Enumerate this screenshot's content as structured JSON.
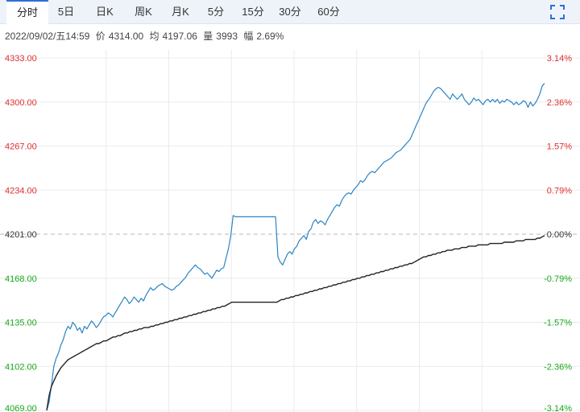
{
  "tabs": [
    {
      "label": "分时",
      "active": true
    },
    {
      "label": "5日",
      "active": false
    },
    {
      "label": "日K",
      "active": false
    },
    {
      "label": "周K",
      "active": false
    },
    {
      "label": "月K",
      "active": false
    },
    {
      "label": "5分",
      "active": false
    },
    {
      "label": "15分",
      "active": false
    },
    {
      "label": "30分",
      "active": false
    },
    {
      "label": "60分",
      "active": false
    }
  ],
  "toolbar": {
    "fullscreen_icon": "fullscreen-icon"
  },
  "info": {
    "datetime": "2022/09/02/五14:59",
    "price_label": "价",
    "price": "4314.00",
    "avg_label": "均",
    "avg": "4197.06",
    "volume_label": "量",
    "volume": "3993",
    "change_label": "幅",
    "change": "2.69%"
  },
  "colors": {
    "up": "#e03030",
    "down": "#1aa81a",
    "neutral": "#333333",
    "price_line": "#2b84c4",
    "avg_line": "#222222",
    "grid": "#e8ecf0",
    "tab_active": "#2d6fd6"
  },
  "chart_data": {
    "type": "line",
    "ylim": [
      4069,
      4333
    ],
    "base": 4201,
    "y_ticks": [
      "4333.00",
      "4300.00",
      "4267.00",
      "4234.00",
      "4201.00",
      "4168.00",
      "4135.00",
      "4102.00",
      "4069.00"
    ],
    "pct_ticks": [
      "3.14%",
      "2.36%",
      "1.57%",
      "0.79%",
      "0.00%",
      "-0.79%",
      "-1.57%",
      "-2.36%",
      "-3.14%"
    ],
    "series": [
      {
        "values": [
          4069,
          4075,
          4088,
          4102,
          4108,
          4112,
          4118,
          4122,
          4128,
          4132,
          4130,
          4135,
          4133,
          4129,
          4131,
          4127,
          4132,
          4130,
          4133,
          4136,
          4134,
          4131,
          4133,
          4136,
          4139,
          4140,
          4142,
          4141,
          4139,
          4142,
          4145,
          4148,
          4151,
          4154,
          4152,
          4149,
          4151,
          4154,
          4152,
          4150,
          4153,
          4151,
          4155,
          4158,
          4161,
          4159,
          4160,
          4162,
          4163,
          4164,
          4162,
          4161,
          4160,
          4159,
          4160,
          4162,
          4163,
          4165,
          4167,
          4169,
          4172,
          4174,
          4176,
          4178,
          4176,
          4175,
          4173,
          4171,
          4172,
          4170,
          4168,
          4171,
          4174,
          4173,
          4175,
          4176,
          4183,
          4190,
          4200,
          4215,
          4214,
          4214,
          4214,
          4214,
          4214,
          4214,
          4214,
          4214,
          4214,
          4214,
          4214,
          4214,
          4214,
          4214,
          4214,
          4214,
          4214,
          4214,
          4184,
          4180,
          4178,
          4182,
          4186,
          4188,
          4186,
          4190,
          4192,
          4196,
          4198,
          4200,
          4197,
          4203,
          4205,
          4210,
          4212,
          4209,
          4211,
          4210,
          4208,
          4212,
          4215,
          4218,
          4221,
          4223,
          4222,
          4226,
          4229,
          4231,
          4232,
          4231,
          4234,
          4236,
          4238,
          4241,
          4240,
          4242,
          4245,
          4247,
          4248,
          4247,
          4249,
          4251,
          4253,
          4255,
          4256,
          4257,
          4258,
          4260,
          4262,
          4263,
          4264,
          4266,
          4268,
          4270,
          4272,
          4276,
          4280,
          4284,
          4288,
          4292,
          4296,
          4300,
          4302,
          4305,
          4308,
          4310,
          4311,
          4310,
          4308,
          4306,
          4304,
          4302,
          4306,
          4304,
          4302,
          4304,
          4306,
          4302,
          4300,
          4298,
          4300,
          4303,
          4301,
          4302,
          4300,
          4298,
          4301,
          4302,
          4300,
          4302,
          4300,
          4302,
          4299,
          4301,
          4300,
          4302,
          4301,
          4300,
          4298,
          4300,
          4298,
          4299,
          4301,
          4300,
          4296,
          4300,
          4297,
          4299,
          4302,
          4306,
          4312,
          4314
        ]
      },
      {
        "values": [
          4069,
          4080,
          4087,
          4091,
          4095,
          4098,
          4101,
          4103,
          4105,
          4107,
          4108,
          4109,
          4110,
          4111,
          4112,
          4113,
          4114,
          4115,
          4116,
          4117,
          4118,
          4119,
          4119,
          4120,
          4121,
          4121,
          4122,
          4123,
          4124,
          4124,
          4125,
          4125,
          4126,
          4127,
          4127,
          4128,
          4128,
          4129,
          4129,
          4130,
          4130,
          4131,
          4131,
          4131,
          4132,
          4132,
          4133,
          4133,
          4134,
          4134,
          4135,
          4135,
          4136,
          4136,
          4137,
          4137,
          4138,
          4138,
          4139,
          4139,
          4140,
          4140,
          4141,
          4141,
          4142,
          4142,
          4143,
          4143,
          4144,
          4144,
          4145,
          4145,
          4146,
          4146,
          4147,
          4147,
          4148,
          4149,
          4150,
          4150,
          4150,
          4150,
          4150,
          4150,
          4150,
          4150,
          4150,
          4150,
          4150,
          4150,
          4150,
          4150,
          4150,
          4150,
          4150,
          4150,
          4150,
          4150,
          4151,
          4152,
          4152,
          4153,
          4153,
          4154,
          4154,
          4155,
          4155,
          4156,
          4156,
          4157,
          4157,
          4158,
          4158,
          4159,
          4159,
          4160,
          4160,
          4161,
          4161,
          4162,
          4162,
          4163,
          4163,
          4164,
          4164,
          4165,
          4165,
          4166,
          4166,
          4167,
          4167,
          4168,
          4168,
          4169,
          4169,
          4170,
          4170,
          4171,
          4171,
          4172,
          4172,
          4173,
          4173,
          4174,
          4174,
          4175,
          4175,
          4176,
          4176,
          4177,
          4177,
          4178,
          4178,
          4179,
          4179,
          4180,
          4181,
          4182,
          4183,
          4184,
          4184,
          4185,
          4185,
          4186,
          4186,
          4187,
          4187,
          4188,
          4188,
          4189,
          4189,
          4189,
          4190,
          4190,
          4190,
          4191,
          4191,
          4191,
          4192,
          4192,
          4192,
          4192,
          4193,
          4193,
          4193,
          4193,
          4193,
          4194,
          4194,
          4194,
          4194,
          4194,
          4194,
          4195,
          4195,
          4195,
          4195,
          4195,
          4196,
          4196,
          4196,
          4196,
          4197,
          4197,
          4197,
          4197,
          4197,
          4198,
          4198,
          4199,
          4200
        ]
      }
    ]
  }
}
